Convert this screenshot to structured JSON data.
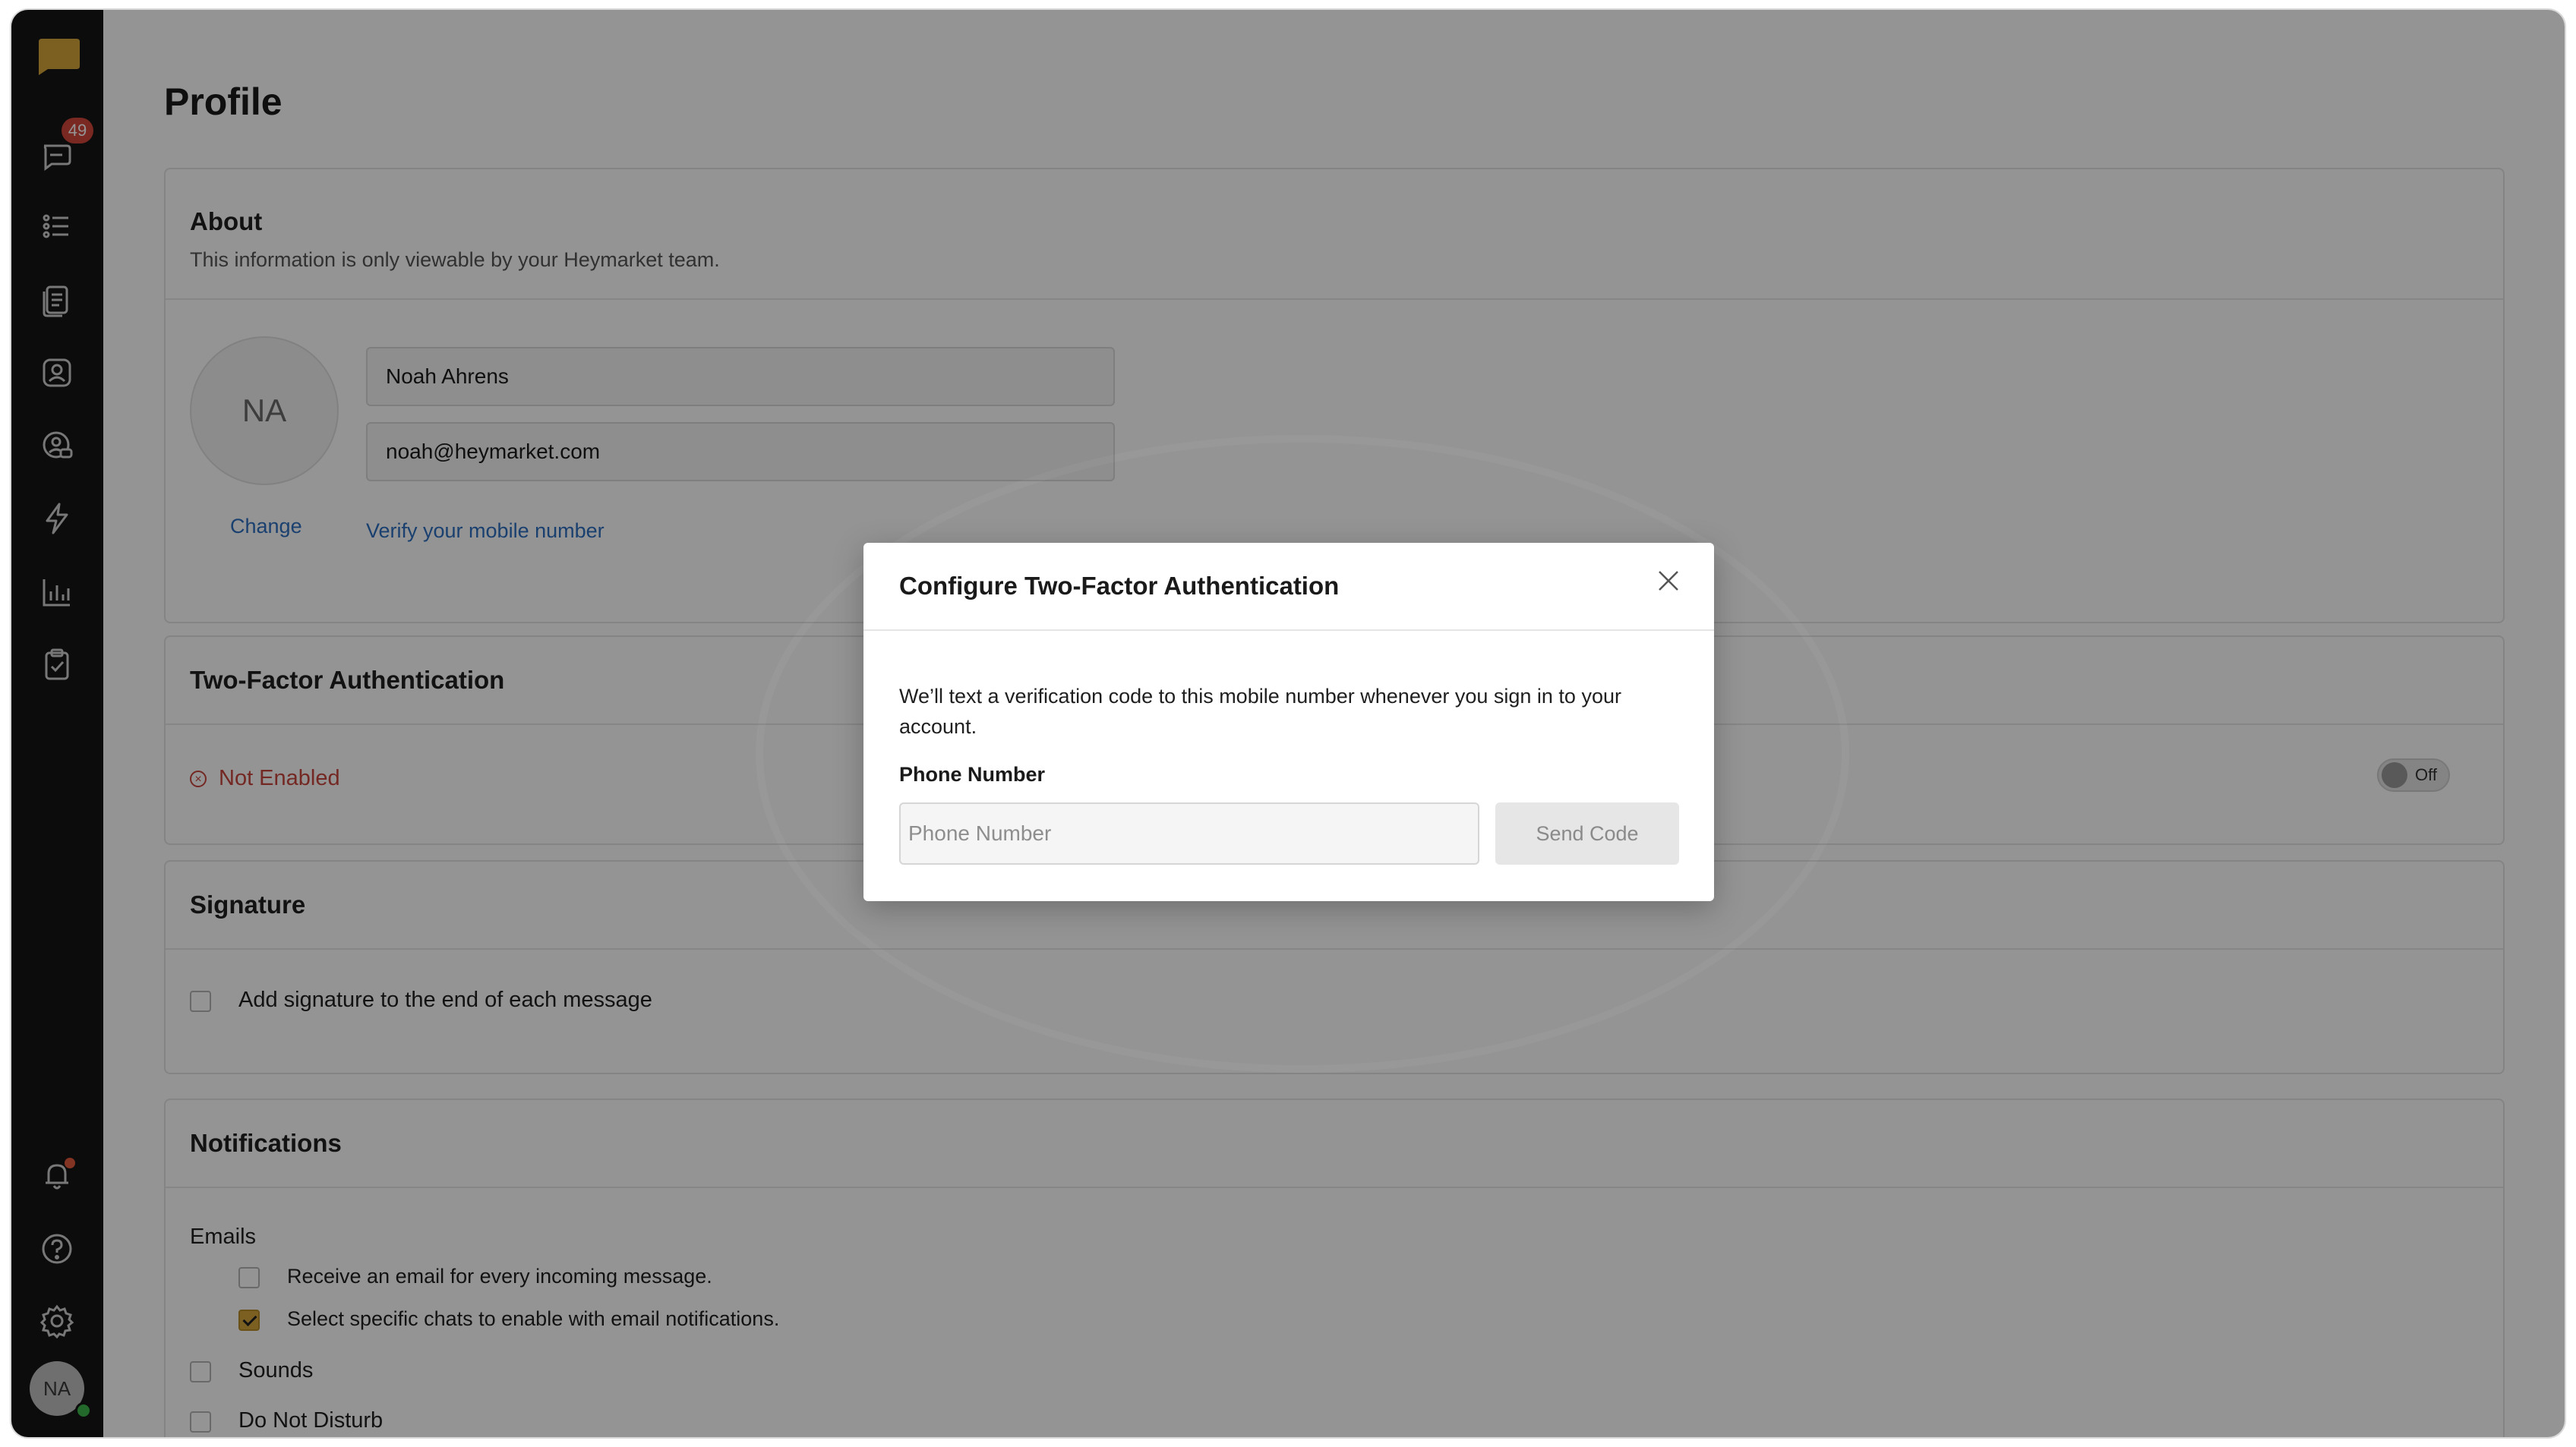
{
  "sidebar": {
    "logo_icon": "chat-bubble-logo-icon",
    "inbox_badge": "49",
    "nav": [
      {
        "icon": "inbox-icon"
      },
      {
        "icon": "list-icon"
      },
      {
        "icon": "documents-icon"
      },
      {
        "icon": "contacts-icon"
      },
      {
        "icon": "contacts-chat-icon"
      },
      {
        "icon": "lightning-icon"
      },
      {
        "icon": "bar-chart-icon"
      },
      {
        "icon": "clipboard-check-icon"
      }
    ],
    "bottom": [
      {
        "icon": "bell-icon"
      },
      {
        "icon": "help-icon"
      },
      {
        "icon": "gear-icon"
      }
    ],
    "avatar_initials": "NA",
    "accent_color": "#d4a53b"
  },
  "page": {
    "title": "Profile"
  },
  "about": {
    "title": "About",
    "subtitle": "This information is only viewable by your Heymarket team.",
    "avatar_initials": "NA",
    "change_label": "Change",
    "name_value": "Noah Ahrens",
    "email_value": "noah@heymarket.com",
    "verify_link": "Verify your mobile number"
  },
  "two_factor": {
    "title": "Two-Factor Authentication",
    "status": "Not Enabled",
    "toggle_label": "Off"
  },
  "signature": {
    "title": "Signature",
    "checkbox_label": "Add signature to the end of each message"
  },
  "notifications": {
    "title": "Notifications",
    "emails_label": "Emails",
    "email_option_1": "Receive an email for every incoming message.",
    "email_option_2": "Select specific chats to enable with email notifications.",
    "sounds_label": "Sounds",
    "dnd_label": "Do Not Disturb"
  },
  "modal": {
    "title": "Configure Two-Factor Authentication",
    "description": "We’ll text a verification code to this mobile number whenever you sign in to your account.",
    "phone_label": "Phone Number",
    "phone_placeholder": "Phone Number",
    "phone_value": "",
    "send_button": "Send Code"
  }
}
